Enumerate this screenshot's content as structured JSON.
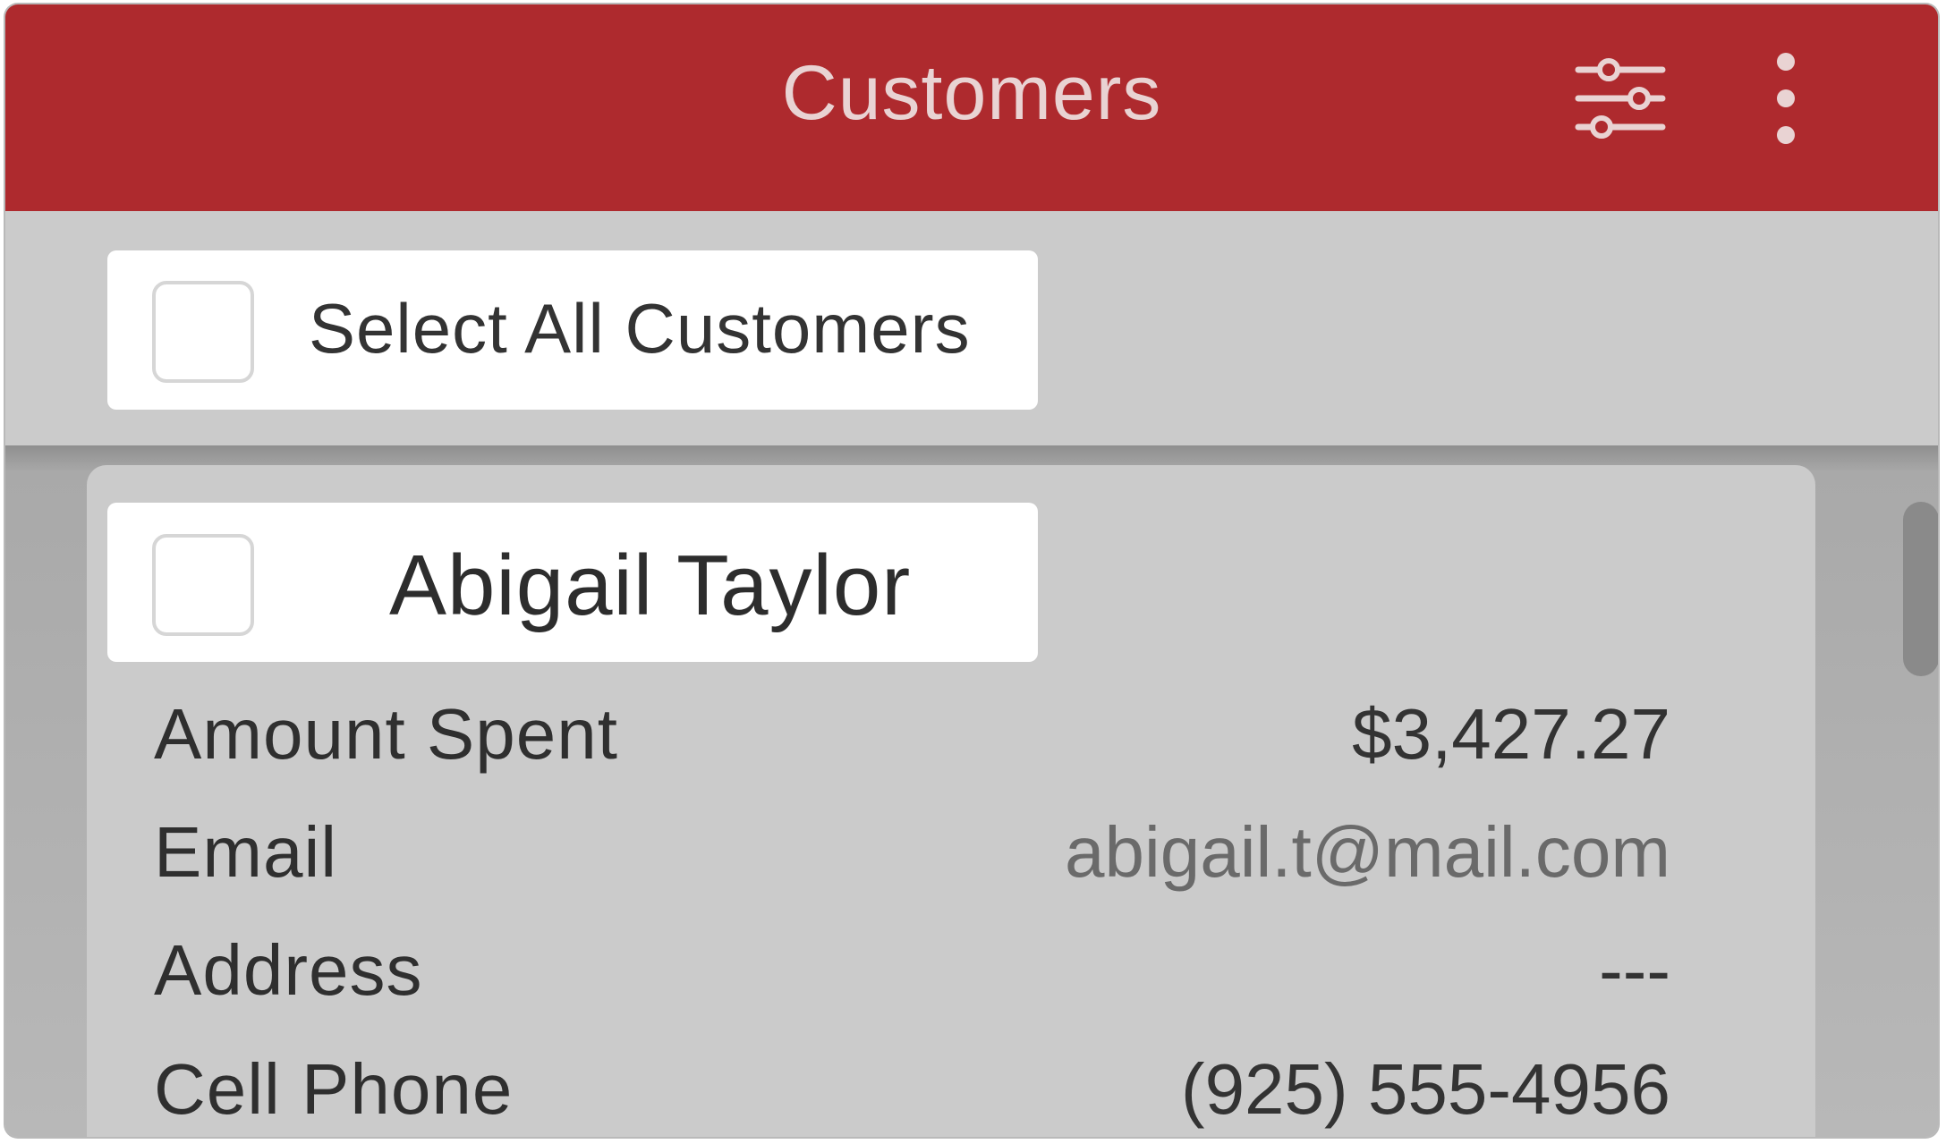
{
  "header": {
    "title": "Customers",
    "accent_color": "#ae2a2e",
    "filter_icon": "sliders-icon",
    "more_icon": "more-vertical-icon"
  },
  "select_all": {
    "label": "Select All Customers",
    "checked": false
  },
  "customers": [
    {
      "name": "Abigail Taylor",
      "checked": false,
      "fields": [
        {
          "label": "Amount Spent",
          "value": "$3,427.27"
        },
        {
          "label": "Email",
          "value": "abigail.t@mail.com"
        },
        {
          "label": "Address",
          "value": "---"
        },
        {
          "label": "Cell Phone",
          "value": "(925) 555-4956"
        }
      ]
    }
  ]
}
